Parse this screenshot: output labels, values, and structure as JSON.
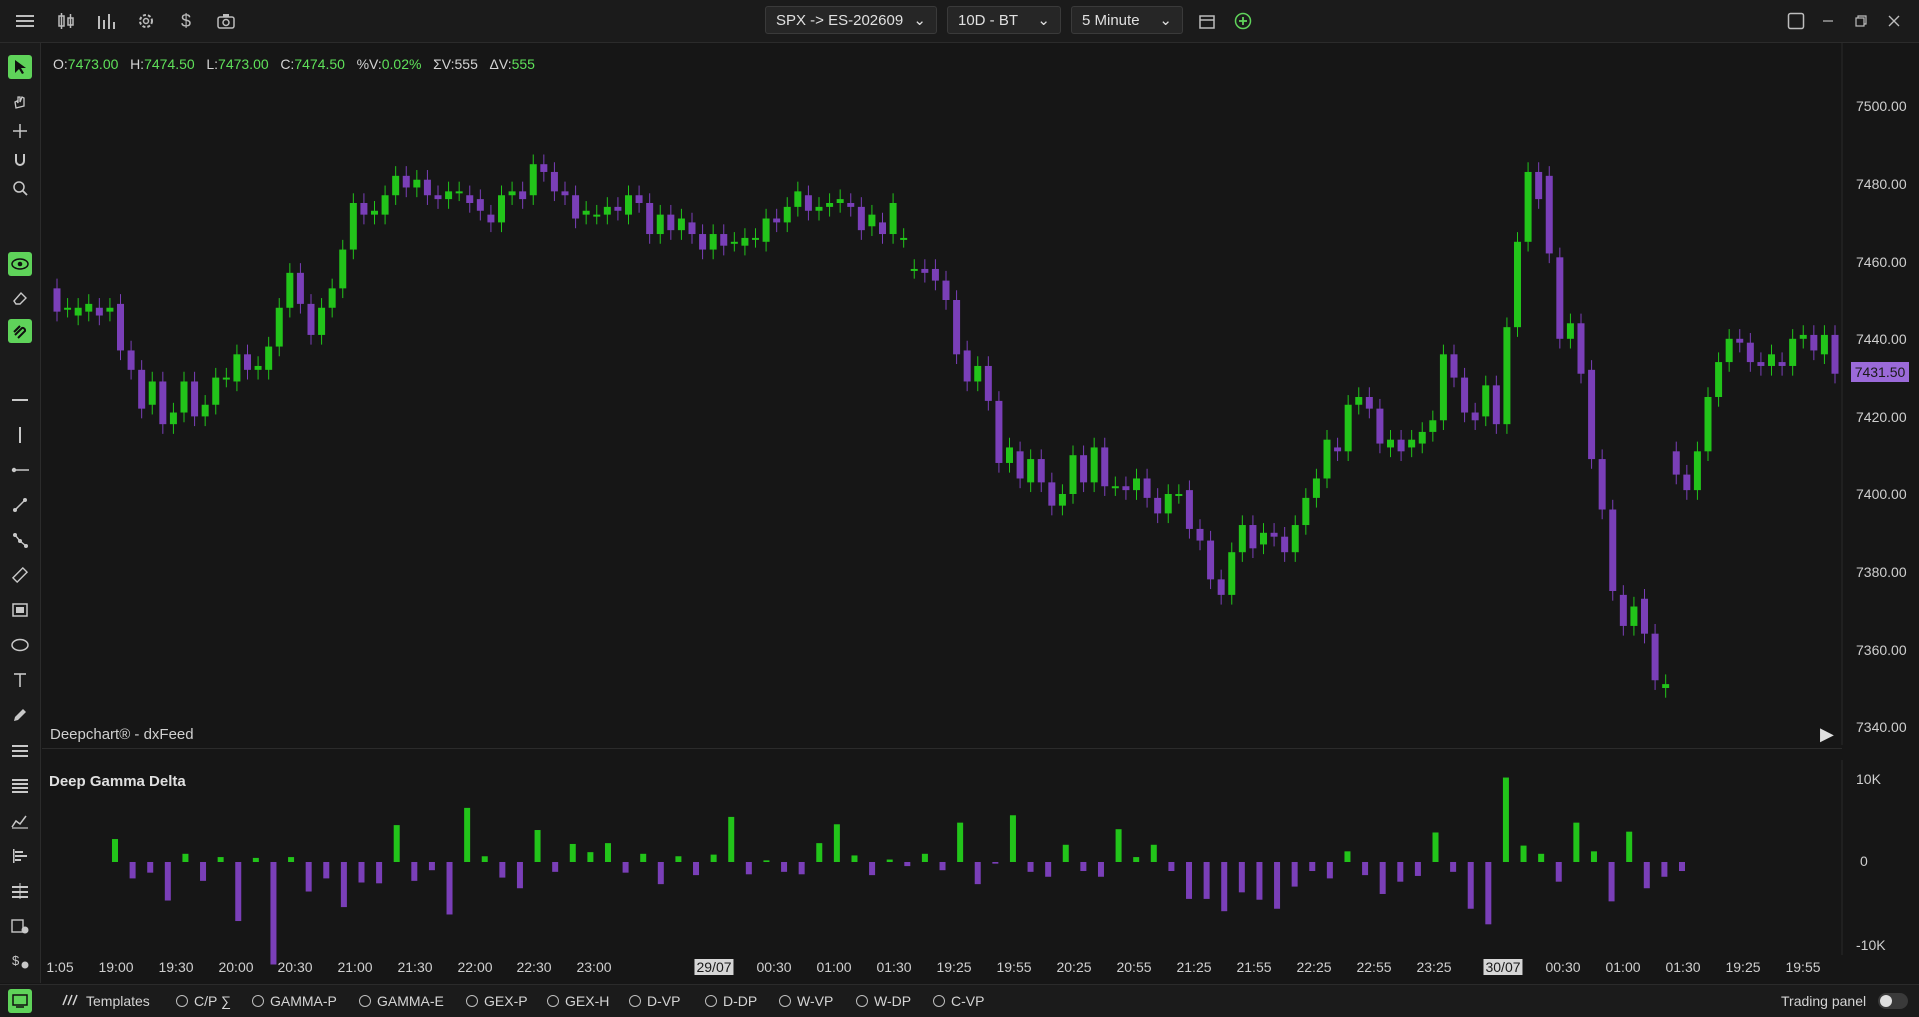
{
  "toolbar": {
    "symbol": "SPX -> ES-202609",
    "range": "10D - BT",
    "interval": "5 Minute",
    "icons": [
      "menu-icon",
      "candles-icon",
      "bars-icon",
      "gear-icon",
      "dollar-icon",
      "camera-icon"
    ]
  },
  "ohlc": {
    "o_label": "O:",
    "o": "7473.00",
    "h_label": "H:",
    "h": "7474.50",
    "l_label": "L:",
    "l": "7473.00",
    "c_label": "C:",
    "c": "7474.50",
    "pv_label": "%V:",
    "pv": "0.02%",
    "sv_label": "ΣV:",
    "sv": "555",
    "dv_label": "ΔV:",
    "dv": "555"
  },
  "price_axis": {
    "labels": [
      "7500.00",
      "7480.00",
      "7460.00",
      "7440.00",
      "7420.00",
      "7400.00",
      "7380.00",
      "7360.00",
      "7340.00"
    ],
    "current": "7431.50"
  },
  "watermark": "Deepchart® - dxFeed",
  "indicator": {
    "title": "Deep Gamma Delta",
    "axis": [
      "10K",
      "0",
      "-10K"
    ]
  },
  "time_axis": {
    "labels": [
      "1:05",
      "19:00",
      "19:30",
      "20:00",
      "20:30",
      "21:00",
      "21:30",
      "22:00",
      "22:30",
      "23:00",
      "29/07",
      "00:30",
      "01:00",
      "01:30",
      "19:25",
      "19:55",
      "20:25",
      "20:55",
      "21:25",
      "21:55",
      "22:25",
      "22:55",
      "23:25",
      "30/07",
      "00:30",
      "01:00",
      "01:30",
      "19:25",
      "19:55"
    ]
  },
  "bottom": {
    "templates": "Templates",
    "indicators": [
      "C/P ∑",
      "GAMMA-P",
      "GAMMA-E",
      "GEX-P",
      "GEX-H",
      "D-VP",
      "D-DP",
      "W-VP",
      "W-DP",
      "C-VP"
    ],
    "trading_panel": "Trading panel"
  },
  "colors": {
    "up": "#22c41a",
    "down": "#7a3fb8",
    "accent": "#5fd35a",
    "current_price": "#9b6ad9"
  },
  "chart_data": {
    "type": "candlestick",
    "series": [
      {
        "name": "ES-202609",
        "values": [
          [
            7453,
            7447
          ],
          [
            7448,
            7448
          ],
          [
            7446,
            7448
          ],
          [
            7447,
            7449
          ],
          [
            7448,
            7446
          ],
          [
            7447,
            7448
          ],
          [
            7449,
            7437
          ],
          [
            7437,
            7432
          ],
          [
            7432,
            7422
          ],
          [
            7423,
            7429
          ],
          [
            7429,
            7418
          ],
          [
            7418,
            7421
          ],
          [
            7421,
            7429
          ],
          [
            7429,
            7420
          ],
          [
            7420,
            7423
          ],
          [
            7423,
            7430
          ],
          [
            7430,
            7430
          ],
          [
            7429,
            7436
          ],
          [
            7436,
            7432
          ],
          [
            7432,
            7433
          ],
          [
            7432,
            7438
          ],
          [
            7438,
            7448
          ],
          [
            7448,
            7457
          ],
          [
            7457,
            7449
          ],
          [
            7449,
            7441
          ],
          [
            7441,
            7448
          ],
          [
            7448,
            7453
          ],
          [
            7453,
            7463
          ],
          [
            7463,
            7475
          ],
          [
            7475,
            7472
          ],
          [
            7472,
            7473
          ],
          [
            7472,
            7477
          ],
          [
            7477,
            7482
          ],
          [
            7482,
            7479
          ],
          [
            7479,
            7481
          ],
          [
            7481,
            7477
          ],
          [
            7477,
            7476
          ],
          [
            7476,
            7478
          ],
          [
            7478,
            7478
          ],
          [
            7477,
            7475
          ],
          [
            7476,
            7473
          ],
          [
            7472,
            7470
          ],
          [
            7470,
            7477
          ],
          [
            7477,
            7478
          ],
          [
            7478,
            7476
          ],
          [
            7477,
            7485
          ],
          [
            7485,
            7483
          ],
          [
            7483,
            7478
          ],
          [
            7478,
            7477
          ],
          [
            7477,
            7471
          ],
          [
            7472,
            7473
          ],
          [
            7472,
            7472
          ],
          [
            7472,
            7474
          ],
          [
            7474,
            7473
          ],
          [
            7472,
            7477
          ],
          [
            7477,
            7475
          ],
          [
            7475,
            7467
          ],
          [
            7467,
            7472
          ],
          [
            7472,
            7468
          ],
          [
            7468,
            7471
          ],
          [
            7470,
            7467
          ],
          [
            7467,
            7463
          ],
          [
            7463,
            7467
          ],
          [
            7467,
            7464
          ],
          [
            7465,
            7465
          ],
          [
            7464,
            7466
          ],
          [
            7466,
            7466
          ],
          [
            7465,
            7471
          ],
          [
            7471,
            7470
          ],
          [
            7470,
            7474
          ],
          [
            7474,
            7478
          ],
          [
            7477,
            7473
          ],
          [
            7473,
            7474
          ],
          [
            7474,
            7475
          ],
          [
            7475,
            7476
          ],
          [
            7475,
            7474
          ],
          [
            7474,
            7468
          ],
          [
            7469,
            7472
          ],
          [
            7470,
            7467
          ],
          [
            7467,
            7475
          ],
          [
            7466,
            7466
          ],
          [
            7458,
            7458
          ],
          [
            7458,
            7457
          ],
          [
            7458,
            7455
          ],
          [
            7455,
            7450
          ],
          [
            7450,
            7436
          ],
          [
            7437,
            7429
          ],
          [
            7429,
            7433
          ],
          [
            7433,
            7424
          ],
          [
            7424,
            7408
          ],
          [
            7408,
            7412
          ],
          [
            7411,
            7404
          ],
          [
            7403,
            7409
          ],
          [
            7409,
            7403
          ],
          [
            7403,
            7397
          ],
          [
            7397,
            7400
          ],
          [
            7400,
            7410
          ],
          [
            7410,
            7403
          ],
          [
            7403,
            7412
          ],
          [
            7412,
            7402
          ],
          [
            7402,
            7402
          ],
          [
            7402,
            7401
          ],
          [
            7401,
            7404
          ],
          [
            7404,
            7399
          ],
          [
            7399,
            7395
          ],
          [
            7395,
            7400
          ],
          [
            7400,
            7400
          ],
          [
            7401,
            7391
          ],
          [
            7391,
            7388
          ],
          [
            7388,
            7378
          ],
          [
            7378,
            7374
          ],
          [
            7374,
            7385
          ],
          [
            7385,
            7392
          ],
          [
            7392,
            7386
          ],
          [
            7387,
            7390
          ],
          [
            7390,
            7389
          ],
          [
            7389,
            7385
          ],
          [
            7385,
            7392
          ],
          [
            7392,
            7399
          ],
          [
            7399,
            7404
          ],
          [
            7404,
            7414
          ],
          [
            7412,
            7411
          ],
          [
            7411,
            7423
          ],
          [
            7423,
            7425
          ],
          [
            7425,
            7422
          ],
          [
            7422,
            7413
          ],
          [
            7412,
            7414
          ],
          [
            7414,
            7411
          ],
          [
            7412,
            7414
          ],
          [
            7413,
            7416
          ],
          [
            7416,
            7419
          ],
          [
            7419,
            7436
          ],
          [
            7436,
            7430
          ],
          [
            7430,
            7421
          ],
          [
            7421,
            7419
          ],
          [
            7420,
            7428
          ],
          [
            7428,
            7418
          ],
          [
            7418,
            7443
          ],
          [
            7443,
            7465
          ],
          [
            7465,
            7483
          ],
          [
            7483,
            7476
          ],
          [
            7482,
            7462
          ],
          [
            7461,
            7440
          ],
          [
            7440,
            7444
          ],
          [
            7444,
            7431
          ],
          [
            7432,
            7409
          ],
          [
            7409,
            7396
          ],
          [
            7396,
            7375
          ],
          [
            7374,
            7366
          ],
          [
            7366,
            7371
          ],
          [
            7373,
            7364
          ],
          [
            7364,
            7352
          ],
          [
            7350,
            7351
          ],
          [
            7411,
            7405
          ],
          [
            7405,
            7401
          ],
          [
            7401,
            7411
          ],
          [
            7411,
            7425
          ],
          [
            7425,
            7434
          ],
          [
            7434,
            7440
          ],
          [
            7440,
            7439
          ],
          [
            7439,
            7434
          ],
          [
            7434,
            7433
          ],
          [
            7433,
            7436
          ],
          [
            7434,
            7433
          ],
          [
            7433,
            7440
          ],
          [
            7440,
            7441
          ],
          [
            7441,
            7437
          ],
          [
            7436,
            7441
          ],
          [
            7441,
            7431
          ]
        ]
      }
    ],
    "delta": [
      2800,
      -2000,
      -1300,
      -4700,
      1000,
      -2300,
      600,
      -7200,
      500,
      -12500,
      600,
      -3600,
      -2000,
      -5500,
      -2500,
      -2600,
      4500,
      -2300,
      -1000,
      -6400,
      6600,
      700,
      -1900,
      -3200,
      3900,
      -1200,
      2200,
      1200,
      2300,
      -1300,
      1000,
      -2700,
      700,
      -1600,
      900,
      5500,
      -1500,
      200,
      -1200,
      -1500,
      2300,
      4600,
      800,
      -1600,
      300,
      -500,
      1000,
      -1000,
      4800,
      -2700,
      -200,
      5700,
      -1200,
      -1800,
      2100,
      -1100,
      -1800,
      4000,
      600,
      2100,
      -1100,
      -4500,
      -4500,
      -6000,
      -3700,
      -4600,
      -5700,
      -3000,
      -1100,
      -2000,
      1300,
      -1600,
      -3900,
      -2400,
      -1700,
      3600,
      -1200,
      -5700,
      -7600,
      10300,
      2000,
      1000,
      -2400,
      4800,
      1300,
      -4800,
      3700,
      -3200,
      -1800,
      -1100
    ],
    "ylim": [
      7336,
      7506
    ],
    "grid": false
  }
}
